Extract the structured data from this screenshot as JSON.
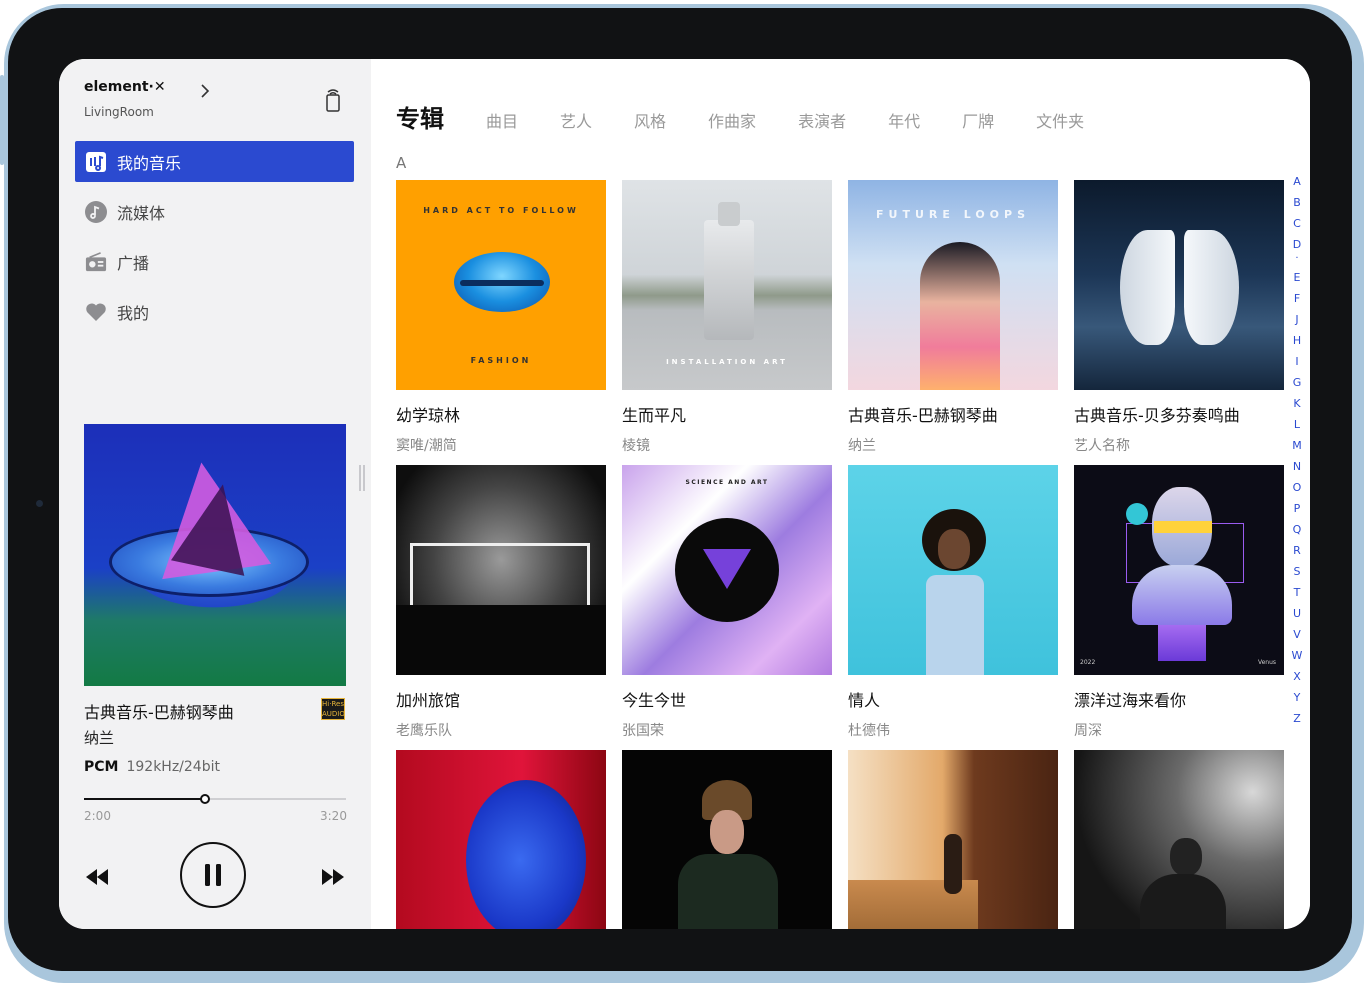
{
  "colors": {
    "accent": "#2b4ad0",
    "frame": "#a9c6dc",
    "bezel": "#111214"
  },
  "sidebar": {
    "brand": "element·✕",
    "room": "LivingRoom",
    "nav": [
      {
        "label": "我的音乐",
        "icon": "music-library-icon",
        "active": true
      },
      {
        "label": "流媒体",
        "icon": "streaming-note-icon",
        "active": false
      },
      {
        "label": "广播",
        "icon": "radio-icon",
        "active": false
      },
      {
        "label": "我的",
        "icon": "heart-icon",
        "active": false
      }
    ]
  },
  "now_playing": {
    "title": "古典音乐-巴赫钢琴曲",
    "artist": "纳兰",
    "badge_top": "Hi·Res",
    "badge_bottom": "AUDIO",
    "format": "PCM",
    "quality": "192kHz/24bit",
    "elapsed": "2:00",
    "duration": "3:20",
    "progress": 0.46
  },
  "tabs": [
    "专辑",
    "曲目",
    "艺人",
    "风格",
    "作曲家",
    "表演者",
    "年代",
    "厂牌",
    "文件夹"
  ],
  "section_letter": "A",
  "albums": [
    {
      "title": "幼学琼林",
      "artist": "窦唯/潮简",
      "art_top": "HARD ACT TO FOLLOW",
      "art_bottom": "FASHION"
    },
    {
      "title": "生而平凡",
      "artist": "棱镜",
      "art_bottom": "INSTALLATION ART"
    },
    {
      "title": "古典音乐-巴赫钢琴曲",
      "artist": "纳兰",
      "art_top": "FUTURE LOOPS"
    },
    {
      "title": "古典音乐-贝多芬奏鸣曲",
      "artist": "艺人名称"
    },
    {
      "title": "加州旅馆",
      "artist": "老鹰乐队"
    },
    {
      "title": "今生今世",
      "artist": "张国荣",
      "art_top": "SCIENCE AND ART"
    },
    {
      "title": "情人",
      "artist": "杜德伟"
    },
    {
      "title": "漂洋过海来看你",
      "artist": "周深",
      "art_left": "2022",
      "art_right": "Venus"
    },
    {
      "title": "",
      "artist": ""
    },
    {
      "title": "",
      "artist": ""
    },
    {
      "title": "",
      "artist": ""
    },
    {
      "title": "",
      "artist": ""
    }
  ],
  "alphabet": [
    "A",
    "B",
    "C",
    "D",
    "·",
    "E",
    "F",
    "J",
    "H",
    "I",
    "G",
    "K",
    "L",
    "M",
    "N",
    "O",
    "P",
    "Q",
    "R",
    "S",
    "T",
    "U",
    "V",
    "W",
    "X",
    "Y",
    "Z"
  ]
}
